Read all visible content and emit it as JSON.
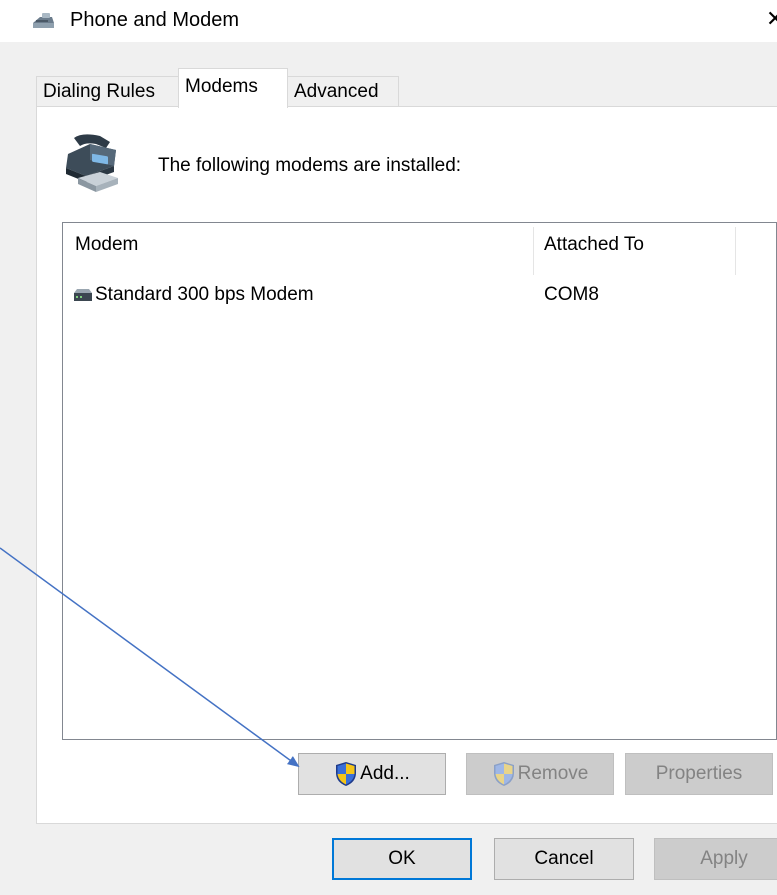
{
  "window": {
    "title": "Phone and Modem",
    "close_glyph": "✕"
  },
  "tabs": [
    {
      "label": "Dialing Rules",
      "active": false
    },
    {
      "label": "Modems",
      "active": true
    },
    {
      "label": "Advanced",
      "active": false
    }
  ],
  "modems_tab": {
    "header_text": "The following modems are installed:",
    "columns": [
      "Modem",
      "Attached To"
    ],
    "rows": [
      {
        "icon": "modem-icon",
        "modem": "Standard  300 bps Modem",
        "attached_to": "COM8"
      }
    ],
    "buttons": {
      "add": "Add...",
      "remove": "Remove",
      "properties": "Properties"
    }
  },
  "footer": {
    "ok": "OK",
    "cancel": "Cancel",
    "apply": "Apply"
  },
  "colors": {
    "accent": "#0078d7",
    "annotation_arrow": "#4472c4"
  }
}
